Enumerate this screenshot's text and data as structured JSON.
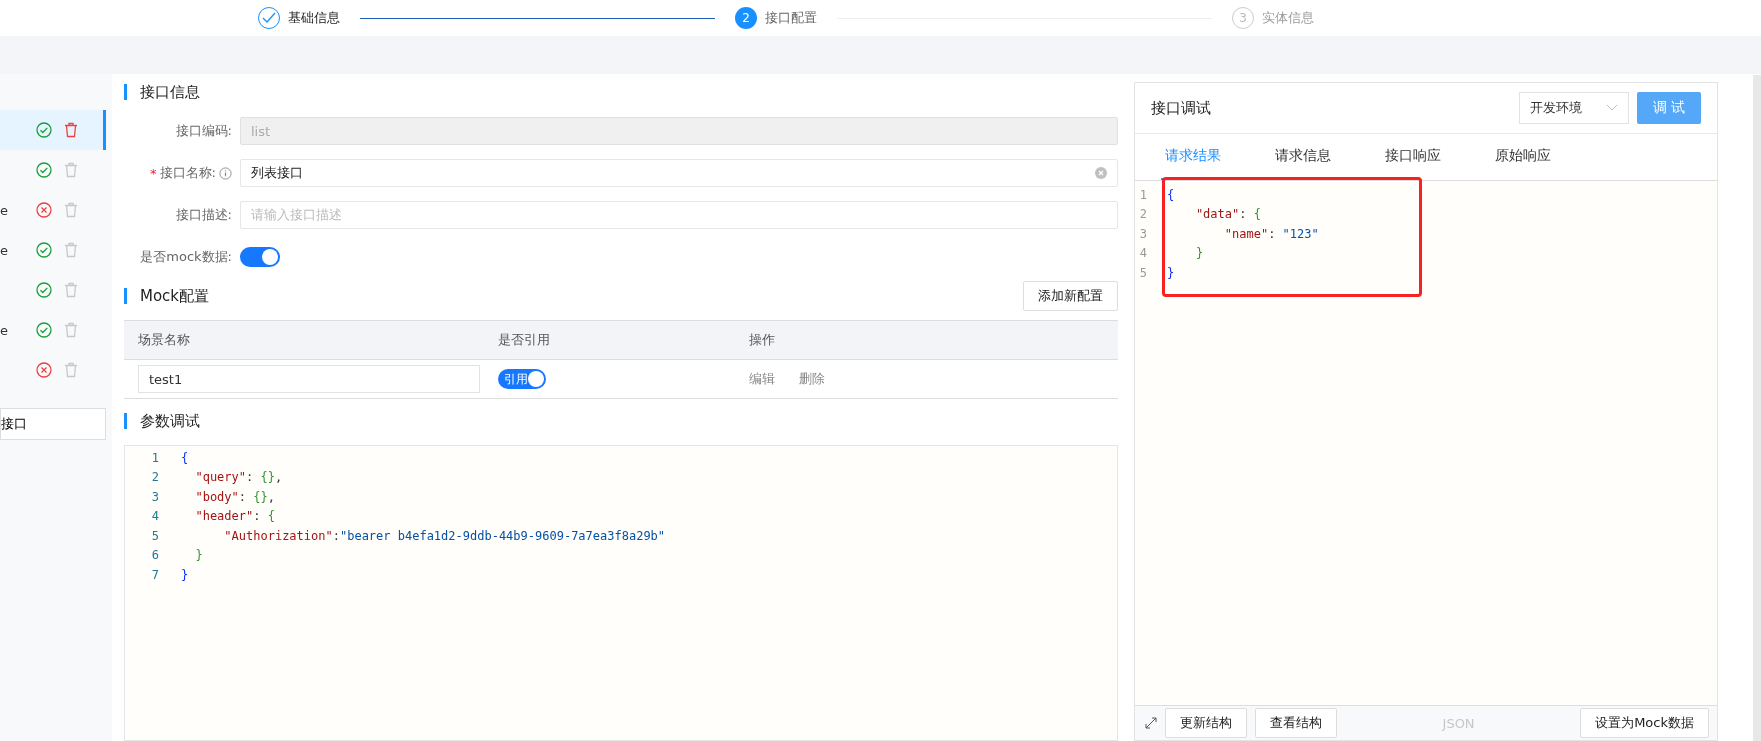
{
  "steps": [
    {
      "label": "基础信息",
      "done": true,
      "current": false
    },
    {
      "index": "2",
      "label": "接口配置",
      "done": false,
      "current": true
    },
    {
      "index": "3",
      "label": "实体信息",
      "done": false,
      "current": false
    }
  ],
  "sidebar": {
    "items": [
      {
        "valid": true,
        "selected": true
      },
      {
        "valid": true,
        "selected": false
      },
      {
        "label": "e",
        "valid": false,
        "selected": false
      },
      {
        "label": "e",
        "valid": true,
        "selected": false
      },
      {
        "valid": true,
        "selected": false
      },
      {
        "label": "e",
        "valid": true,
        "selected": false
      },
      {
        "valid": false,
        "selected": false
      }
    ],
    "add_button": "接口"
  },
  "interface_info": {
    "title": "接口信息",
    "fields": [
      {
        "label": "接口编码:",
        "value": "list",
        "disabled": true,
        "info": false,
        "clearable": false
      },
      {
        "label": "接口名称:",
        "value": "列表接口",
        "disabled": false,
        "required_mark": "*",
        "info": true,
        "clearable": true
      },
      {
        "label": "接口描述:",
        "placeholder": "请输入接口描述",
        "disabled": false,
        "info": false,
        "clearable": false
      }
    ],
    "mock_switch": {
      "label": "是否mock数据:",
      "on": true
    }
  },
  "mock_config": {
    "title": "Mock配置",
    "add_button": "添加新配置",
    "columns": [
      "场景名称",
      "是否引用",
      "操作"
    ],
    "rows": [
      {
        "name": "test1",
        "switch_label": "引用",
        "on": true,
        "actions": [
          "编辑",
          "删除"
        ]
      }
    ]
  },
  "param_debug": {
    "title": "参数调试",
    "code": [
      {
        "number": "1",
        "tokens": [
          {
            "text": "{",
            "kind": "brace1"
          }
        ]
      },
      {
        "number": "2",
        "tokens": [
          {
            "text": "  \"query\"",
            "kind": "key"
          },
          {
            "text": ": ",
            "kind": "punct"
          },
          {
            "text": "{}",
            "kind": "brace2"
          },
          {
            "text": ",",
            "kind": "punct"
          }
        ]
      },
      {
        "number": "3",
        "tokens": [
          {
            "text": "  \"body\"",
            "kind": "key"
          },
          {
            "text": ": ",
            "kind": "punct"
          },
          {
            "text": "{}",
            "kind": "brace2"
          },
          {
            "text": ",",
            "kind": "punct"
          }
        ]
      },
      {
        "number": "4",
        "tokens": [
          {
            "text": "  \"header\"",
            "kind": "key"
          },
          {
            "text": ": ",
            "kind": "punct"
          },
          {
            "text": "{",
            "kind": "brace2"
          }
        ]
      },
      {
        "number": "5",
        "tokens": [
          {
            "text": "      \"Authorization\"",
            "kind": "key"
          },
          {
            "text": ":",
            "kind": "punct"
          },
          {
            "text": "\"bearer b4efa1d2-9ddb-44b9-9609-7a7ea3f8a29b\"",
            "kind": "string"
          }
        ]
      },
      {
        "number": "6",
        "tokens": [
          {
            "text": "  }",
            "kind": "brace2"
          }
        ]
      },
      {
        "number": "7",
        "tokens": [
          {
            "text": "}",
            "kind": "brace1"
          }
        ]
      }
    ]
  },
  "debug_panel": {
    "title": "接口调试",
    "environment": "开发环境",
    "run_button": "调 试",
    "tabs": [
      {
        "label": "请求结果",
        "selected": true
      },
      {
        "label": "请求信息",
        "selected": false
      },
      {
        "label": "接口响应",
        "selected": false
      },
      {
        "label": "原始响应",
        "selected": false
      }
    ],
    "code": [
      {
        "number": "1",
        "tokens": [
          {
            "text": "{",
            "kind": "brace1"
          }
        ]
      },
      {
        "number": "2",
        "tokens": [
          {
            "text": "    \"data\"",
            "kind": "key"
          },
          {
            "text": ": ",
            "kind": "punct"
          },
          {
            "text": "{",
            "kind": "brace2"
          }
        ]
      },
      {
        "number": "3",
        "tokens": [
          {
            "text": "        \"name\"",
            "kind": "key"
          },
          {
            "text": ": ",
            "kind": "punct"
          },
          {
            "text": "\"123\"",
            "kind": "string"
          }
        ]
      },
      {
        "number": "4",
        "tokens": [
          {
            "text": "    }",
            "kind": "brace2"
          }
        ]
      },
      {
        "number": "5",
        "tokens": [
          {
            "text": "}",
            "kind": "brace1"
          }
        ]
      }
    ],
    "footer": {
      "buttons": [
        "更新结构",
        "查看结构"
      ],
      "format_label": "JSON",
      "mock_button": "设置为Mock数据"
    }
  }
}
